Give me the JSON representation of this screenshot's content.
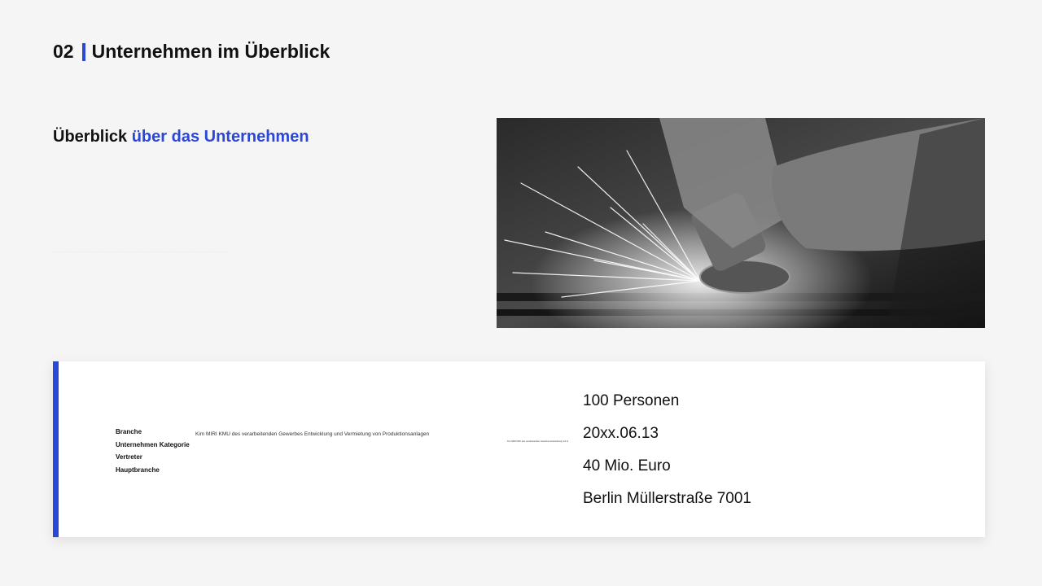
{
  "header": {
    "number": "02",
    "title": "Unternehmen im Überblick"
  },
  "subtitle": {
    "part1": "Überblick",
    "part2": "über das Unternehmen"
  },
  "photo": {
    "description": "Winkelschleifer mit Funkenflug"
  },
  "card": {
    "labels": [
      "Branche",
      "Unternehmen Kategorie",
      "Vertreter",
      "Hauptbranche"
    ],
    "description": "Kim MIRI KMU des verarbeitenden Gewerbes Entwicklung und Vermietung von Produktionsanlagen",
    "values": [
      "100 Personen",
      "20xx.06.13",
      "40 Mio. Euro",
      "Berlin Müllerstraße 7001"
    ]
  }
}
